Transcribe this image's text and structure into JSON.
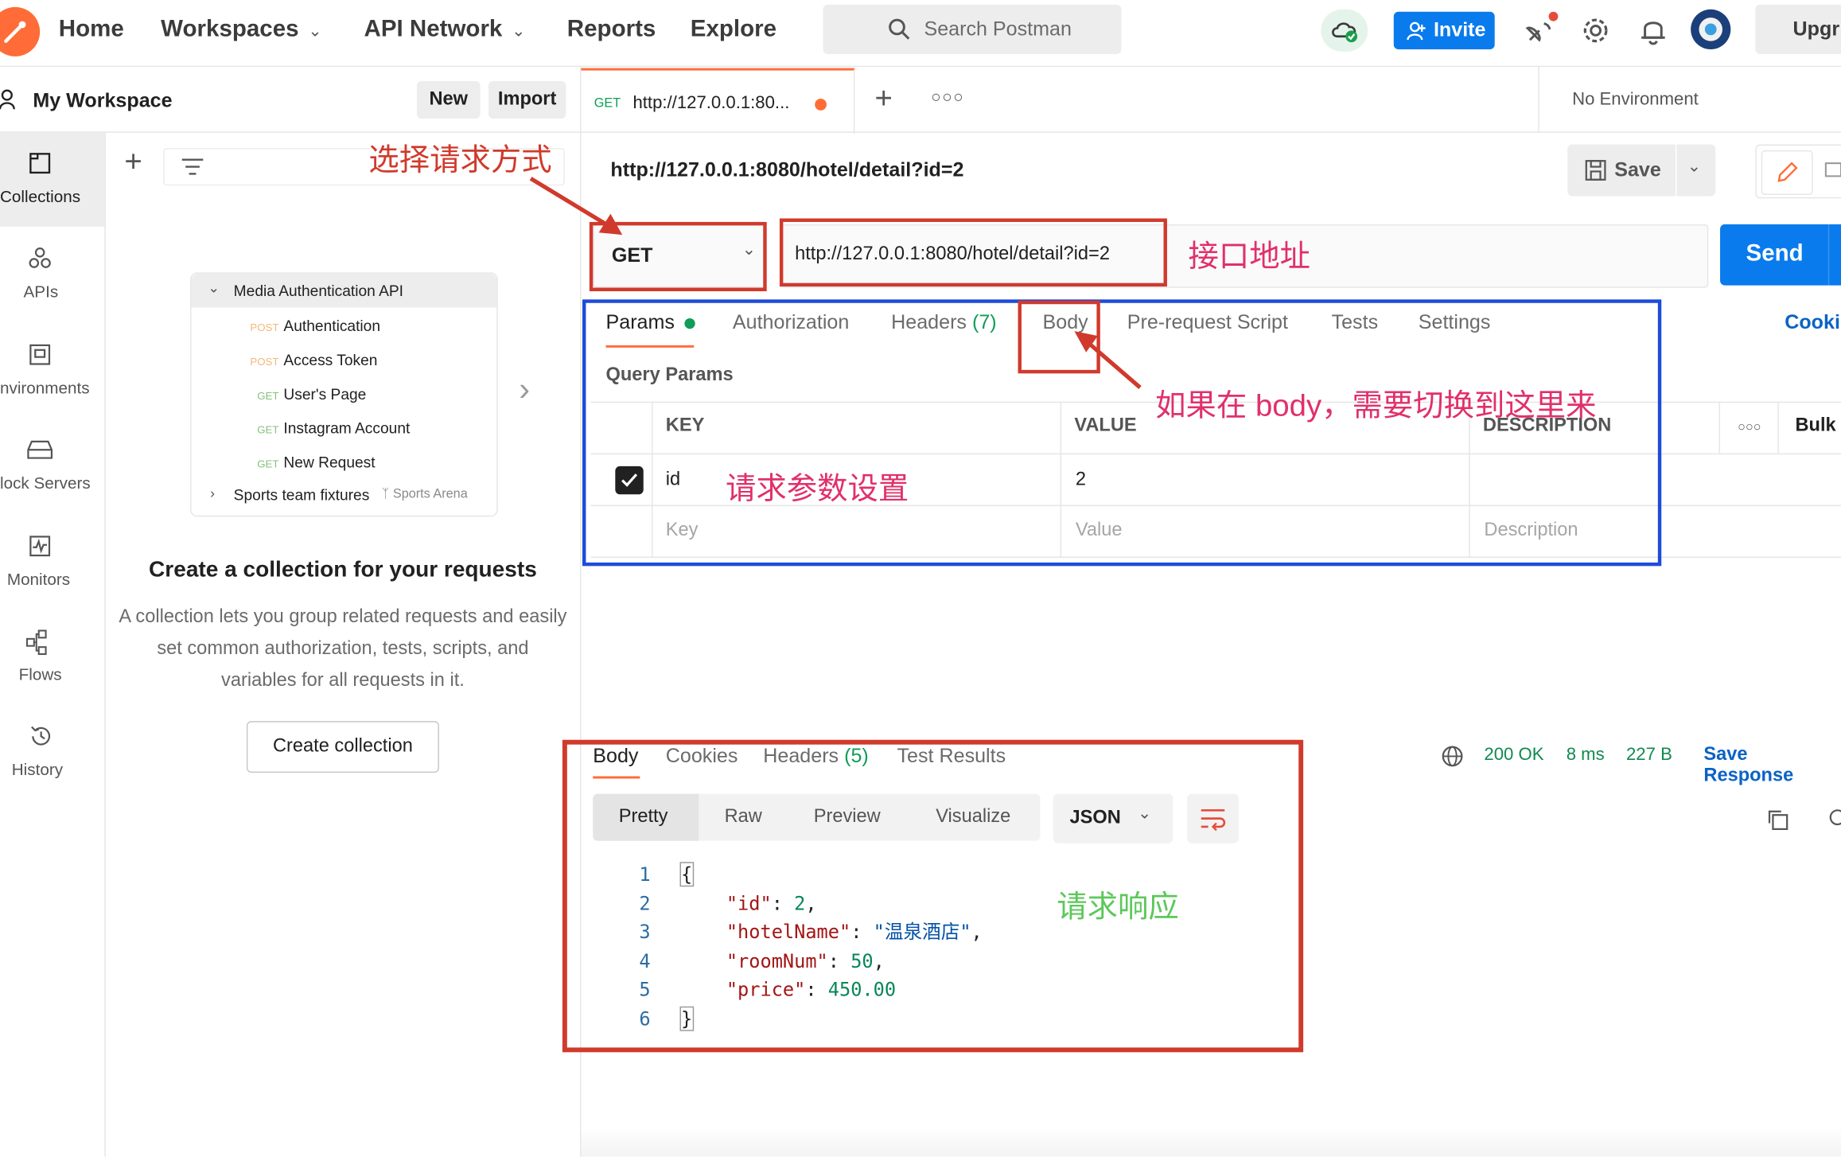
{
  "topbar": {
    "nav": [
      "Home",
      "Workspaces",
      "API Network",
      "Reports",
      "Explore"
    ],
    "search_placeholder": "Search Postman",
    "invite": "Invite",
    "upgrade": "Upgr"
  },
  "sidebar": {
    "workspace": "My Workspace",
    "new": "New",
    "import": "Import",
    "rail": [
      "Collections",
      "APIs",
      "nvironments",
      "lock Servers",
      "Monitors",
      "Flows",
      "History"
    ],
    "tree": {
      "collection": "Media Authentication API",
      "requests": [
        {
          "method": "POST",
          "name": "Authentication"
        },
        {
          "method": "POST",
          "name": "Access Token"
        },
        {
          "method": "GET",
          "name": "User's Page"
        },
        {
          "method": "GET",
          "name": "Instagram Account"
        },
        {
          "method": "GET",
          "name": "New Request"
        }
      ],
      "other": "Sports team fixtures",
      "other_tag": "Sports Arena"
    },
    "cta_title": "Create a collection for your requests",
    "cta_desc": "A collection lets you group related requests and easily set common authorization, tests, scripts, and variables for all requests in it.",
    "cta_button": "Create collection"
  },
  "tabs": {
    "method": "GET",
    "title": "http://127.0.0.1:80...",
    "environment": "No Environment"
  },
  "request": {
    "name": "http://127.0.0.1:8080/hotel/detail?id=2",
    "save": "Save",
    "method": "GET",
    "url": "http://127.0.0.1:8080/hotel/detail?id=2",
    "send": "Send",
    "subtabs": [
      "Params",
      "Authorization",
      "Headers",
      "Body",
      "Pre-request Script",
      "Tests",
      "Settings"
    ],
    "headers_count": "(7)",
    "cookies": "Cooki",
    "query_title": "Query Params",
    "cols": [
      "KEY",
      "VALUE",
      "DESCRIPTION"
    ],
    "bulk": "Bulk",
    "row": {
      "key": "id",
      "value": "2"
    },
    "placeholder": {
      "key": "Key",
      "value": "Value",
      "desc": "Description"
    }
  },
  "response": {
    "tabs": [
      "Body",
      "Cookies",
      "Headers",
      "Test Results"
    ],
    "headers_count": "(5)",
    "status": "200 OK",
    "time": "8 ms",
    "size": "227 B",
    "save": "Save Response",
    "views": [
      "Pretty",
      "Raw",
      "Preview",
      "Visualize"
    ],
    "format": "JSON",
    "lines": [
      "1",
      "2",
      "3",
      "4",
      "5",
      "6"
    ],
    "json": {
      "open": "{",
      "k1": "\"id\"",
      "v1": "2",
      "k2": "\"hotelName\"",
      "v2": "\"温泉酒店\"",
      "k3": "\"roomNum\"",
      "v3": "50",
      "k4": "\"price\"",
      "v4": "450.00",
      "close": "}"
    }
  },
  "annotations": {
    "method": "选择请求方式",
    "url": "接口地址",
    "body": "如果在 body，需要切换到这里来",
    "params": "请求参数设置",
    "response": "请求响应"
  },
  "colors": {
    "accent": "#ff6c37",
    "blue": "#097bed",
    "annot_red": "#d03a2c",
    "annot_pink": "#e0306a",
    "annot_blue": "#1e4cd8",
    "annot_green": "#5cc85a"
  }
}
